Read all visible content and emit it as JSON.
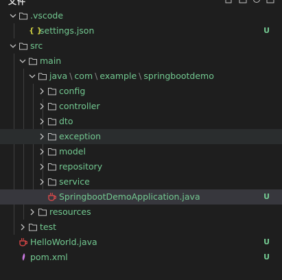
{
  "header": {
    "title": "文件"
  },
  "colors": {
    "untracked": "#73c991",
    "text": "#cccccc",
    "json": "#cbcb41",
    "java": "#f14c4c",
    "xml": "#c678dd"
  },
  "tree": {
    "vscode": {
      "label": ".vscode"
    },
    "settings": {
      "label": "settings.json",
      "badge": "U"
    },
    "src": {
      "label": "src"
    },
    "main": {
      "label": "main"
    },
    "java_path": {
      "p1": "java",
      "p2": "com",
      "p3": "example",
      "p4": "springbootdemo",
      "sep": "\\"
    },
    "config": {
      "label": "config"
    },
    "controller": {
      "label": "controller"
    },
    "dto": {
      "label": "dto"
    },
    "exception": {
      "label": "exception"
    },
    "model": {
      "label": "model"
    },
    "repository": {
      "label": "repository"
    },
    "service": {
      "label": "service"
    },
    "app": {
      "label": "SpringbootDemoApplication.java",
      "badge": "U"
    },
    "resources": {
      "label": "resources"
    },
    "test": {
      "label": "test"
    },
    "hello": {
      "label": "HelloWorld.java",
      "badge": "U"
    },
    "pom": {
      "label": "pom.xml",
      "badge": "U"
    }
  }
}
